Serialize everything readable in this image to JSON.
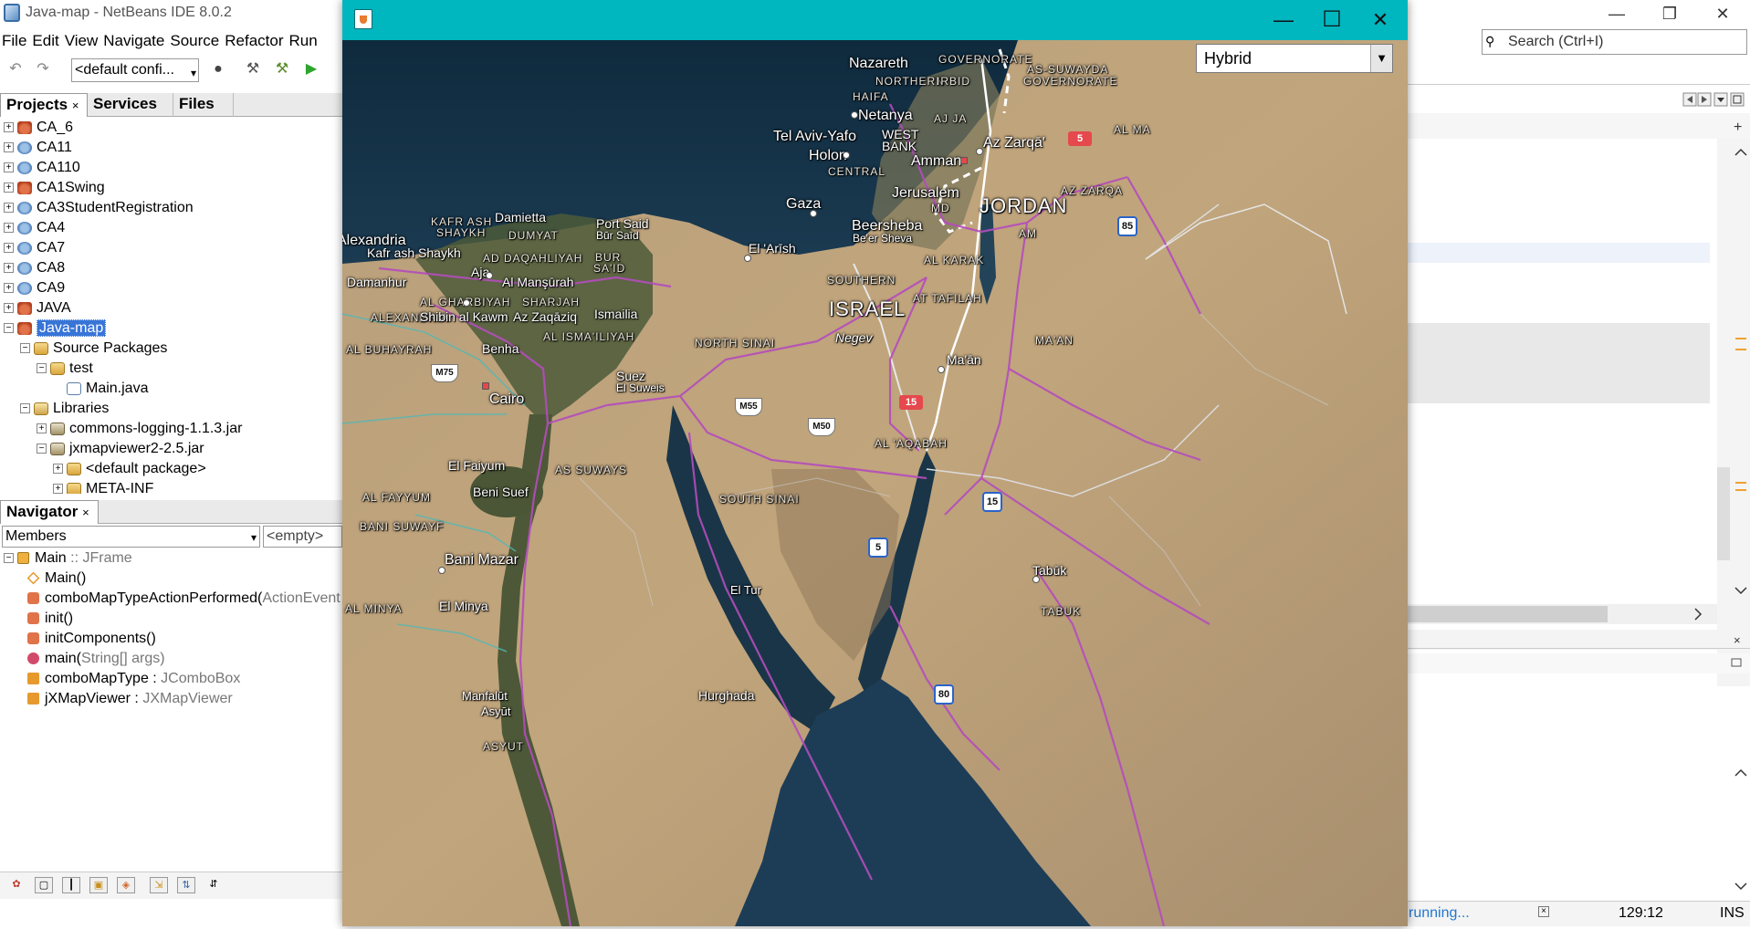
{
  "ide": {
    "title": "Java-map - NetBeans IDE 8.0.2",
    "window_controls": {
      "minimize": "—",
      "restore": "❐",
      "close": "✕"
    },
    "menu": [
      "File",
      "Edit",
      "View",
      "Navigate",
      "Source",
      "Refactor",
      "Run"
    ],
    "config_select": "<default confi...",
    "search_placeholder": "Search (Ctrl+I)",
    "project_tabs": [
      "Projects",
      "Services",
      "Files"
    ],
    "project_tab_close": "×",
    "project_tree": [
      {
        "label": "CA_6",
        "icon": "java-project-icon"
      },
      {
        "label": "CA11",
        "icon": "web-project-icon"
      },
      {
        "label": "CA110",
        "icon": "web-project-icon"
      },
      {
        "label": "CA1Swing",
        "icon": "java-project-icon"
      },
      {
        "label": "CA3StudentRegistration",
        "icon": "web-project-icon"
      },
      {
        "label": "CA4",
        "icon": "web-project-icon"
      },
      {
        "label": "CA7",
        "icon": "web-project-icon"
      },
      {
        "label": "CA8",
        "icon": "web-project-icon"
      },
      {
        "label": "CA9",
        "icon": "web-project-icon"
      },
      {
        "label": "JAVA",
        "icon": "java-project-icon"
      },
      {
        "label": "Java-map",
        "icon": "java-project-icon"
      },
      {
        "label": "Source Packages",
        "icon": "source-packages-icon"
      },
      {
        "label": "test",
        "icon": "package-icon"
      },
      {
        "label": "Main.java",
        "icon": "java-file-icon"
      },
      {
        "label": "Libraries",
        "icon": "libraries-icon"
      },
      {
        "label": "commons-logging-1.1.3.jar",
        "icon": "jar-icon"
      },
      {
        "label": "jxmapviewer2-2.5.jar",
        "icon": "jar-icon"
      },
      {
        "label": "<default package>",
        "icon": "package-icon"
      },
      {
        "label": "META-INF",
        "icon": "package-icon"
      }
    ],
    "navigator": {
      "title": "Navigator",
      "close": "×",
      "members_select": "Members",
      "empty_select": "<empty>",
      "items": [
        {
          "name": "Main",
          "type": " :: JFrame"
        },
        {
          "name": "Main()",
          "type": ""
        },
        {
          "name": "comboMapTypeActionPerformed(",
          "type": "ActionEvent"
        },
        {
          "name": "init()",
          "type": ""
        },
        {
          "name": "initComponents()",
          "type": ""
        },
        {
          "name": "main(",
          "type": "String[] args)"
        },
        {
          "name": "comboMapType : ",
          "type": "JComboBox"
        },
        {
          "name": "jXMapViewer : ",
          "type": "JXMapViewer"
        }
      ]
    },
    "status": {
      "running": "running...",
      "position": "129:12",
      "mode": "INS"
    }
  },
  "map_window": {
    "window_controls": {
      "minimize": "—",
      "maximize": "☐",
      "close": "✕"
    },
    "map_type": "Hybrid",
    "labels": {
      "nazareth": "Nazareth",
      "haifa": "HAIFA",
      "netanya": "Netanya",
      "tel_aviv": "Tel Aviv-Yafo",
      "holon": "Holon",
      "central": "CENTRAL",
      "west_bank": "WEST",
      "west_bank2": "BANK",
      "amman": "Amman",
      "az_zarqa": "Az Zarqā'",
      "jerusalem": "Jerusalem",
      "jordan": "JORDAN",
      "gaza": "Gaza",
      "beersheba": "Beersheba",
      "beer_sheva": "Be'er Sheva",
      "israel": "ISRAEL",
      "negev": "Negev",
      "southern": "SOUTHERN",
      "al_karak": "AL KARAK",
      "at_tafilah": "AT TAFILAH",
      "maan": "Ma'ān",
      "maan_region": "MA'AN",
      "al_aqabah": "AL 'AQABAH",
      "northern": "NORTHERN",
      "irbid": "IRBID",
      "ajlun": "AJ JA",
      "golan": "GOVERNORATE",
      "as_suwayda": "AS-SUWAYDA",
      "as_suwayda2": "GOVERNORATE",
      "al_ma": "AL MA",
      "az_zarqa_region": "AZ ZARQA",
      "am": "AM",
      "md": "MD",
      "alexandria": "Alexandria",
      "alexandria_region": "ALEXANDRIA",
      "damietta": "Damietta",
      "kafr_ash": "KAFR ASH",
      "shaykh": "SHAYKH",
      "dumyat": "DUMYAT",
      "port_said": "Port Said",
      "bur_said": "Būr Saīd",
      "bur": "BUR",
      "said": "SA'ID",
      "kafr_ash_shaykh": "Kafr ash Shaykh",
      "ad_daqahliyah": "AD DAQAHLIYAH",
      "damanhur": "Damanhur",
      "aja": "Aja",
      "al_mansurah": "Al Manşūrah",
      "al_gharbiyah": "AL GHARBIYAH",
      "sharqiyah": "SHARJAH",
      "shibin": "Shibin al Kawm",
      "az_zaqaziq": "Az Zaqāziq",
      "ismailia": "Ismailia",
      "al_ismailiyah": "AL ISMA'ILIYAH",
      "benha": "Benha",
      "al_buhayrah": "AL BUHAYRAH",
      "north_sinai": "NORTH SINAI",
      "el_arish": "El 'Arīsh",
      "suez": "Suez",
      "el_suweis": "El Suweis",
      "cairo": "Cairo",
      "el_faiyum": "El Faiyum",
      "as_suways": "AS SUWAYS",
      "al_fayyum": "AL FAYYUM",
      "beni_suef": "Beni Suef",
      "bani_suwayf": "BANI SUWAYF",
      "south_sinai": "SOUTH SINAI",
      "bani_mazar": "Bani Mazar",
      "al_minya": "AL MINYA",
      "el_minya": "El Minya",
      "el_tur": "El Tur",
      "tabuk": "Tabūk",
      "tabuk_region": "TABUK",
      "manfalut": "Manfalūt",
      "asyut": "Asyūt",
      "asyut_region": "ASYUT",
      "hurghada": "Hurghada"
    },
    "shields": {
      "m75": "M75",
      "m55": "M55",
      "m50": "M50",
      "r5": "5",
      "r15": "15",
      "s15": "15",
      "s5": "5",
      "s85": "85",
      "s80": "80"
    }
  }
}
